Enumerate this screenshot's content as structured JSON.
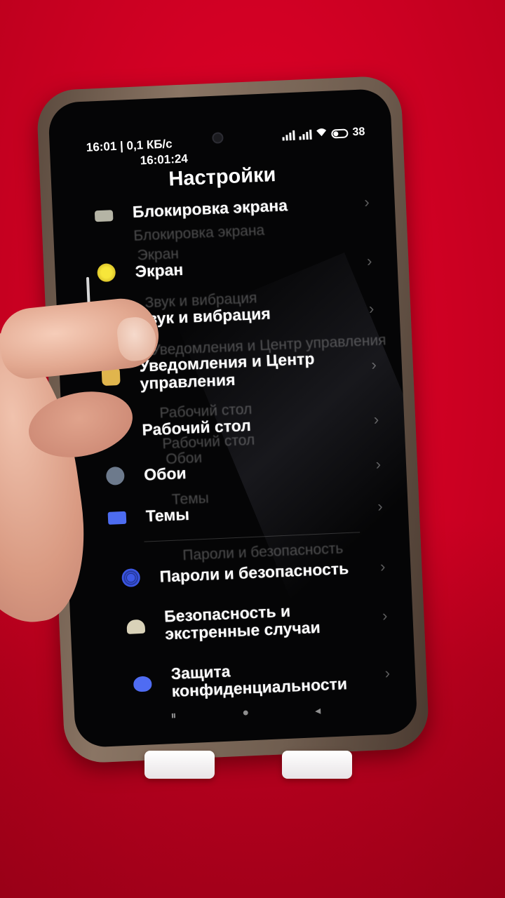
{
  "status_bar": {
    "left_text": "16:01 | 0,1 КБ/с",
    "time_overlay": "16:01:24",
    "battery": "38"
  },
  "header": {
    "title": "Настройки"
  },
  "settings_items": [
    {
      "label": "Блокировка экрана",
      "icon": "lock-screen-icon",
      "color": "#b5b4a5"
    },
    {
      "label": "Экран",
      "icon": "display-icon",
      "color": "#e7d12e"
    },
    {
      "label": "Звук и вибрация",
      "icon": "sound-icon",
      "color": "#b6e05a"
    },
    {
      "label": "Уведомления и Центр управления",
      "icon": "notifications-icon",
      "color": "#e0b54d"
    },
    {
      "label": "Рабочий стол",
      "icon": "home-icon",
      "color": "#3e56e8"
    },
    {
      "label": "Обои",
      "icon": "wallpaper-icon",
      "color": "#6d7a8c"
    },
    {
      "label": "Темы",
      "icon": "themes-icon",
      "color": "#4d6cf0"
    },
    {
      "label": "Пароли и безопасность",
      "icon": "fingerprint-icon",
      "color": "#3c58e6"
    },
    {
      "label": "Безопасность и экстренные случаи",
      "icon": "emergency-icon",
      "color": "#d9d2b8"
    },
    {
      "label": "Защита конфиденциальности",
      "icon": "privacy-icon",
      "color": "#4f6cf2"
    }
  ],
  "nav": {
    "recents": "⏸",
    "home": "●",
    "back": "◂"
  }
}
